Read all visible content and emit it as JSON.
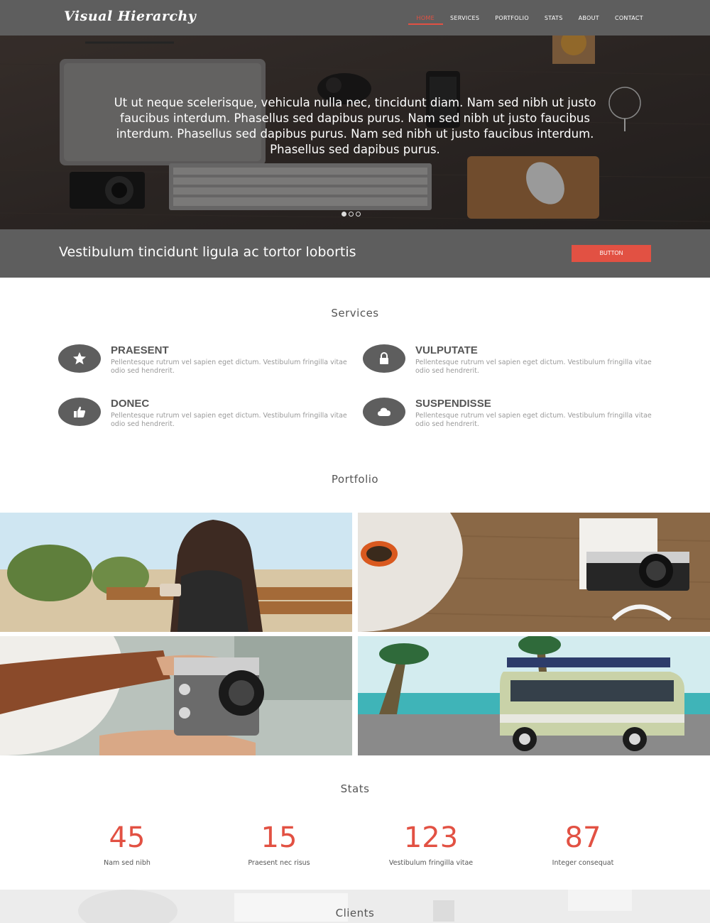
{
  "brand": "Visual Hierarchy",
  "nav": [
    {
      "label": "HOME",
      "active": true
    },
    {
      "label": "SERVICES",
      "active": false
    },
    {
      "label": "PORTFOLIO",
      "active": false
    },
    {
      "label": "STATS",
      "active": false
    },
    {
      "label": "ABOUT",
      "active": false
    },
    {
      "label": "CONTACT",
      "active": false
    }
  ],
  "hero": {
    "text": "Ut ut neque scelerisque, vehicula nulla nec, tincidunt diam. Nam sed nibh ut justo faucibus interdum. Phasellus sed dapibus purus. Nam sed nibh ut justo faucibus interdum. Phasellus sed dapibus purus. Nam sed nibh ut justo faucibus interdum. Phasellus sed dapibus purus.",
    "slides": 3,
    "active_slide": 1
  },
  "cta": {
    "text": "Vestibulum tincidunt ligula ac tortor lobortis",
    "button": "BUTTON"
  },
  "services": {
    "title": "Services",
    "items": [
      {
        "title": "PRAESENT",
        "icon": "star-icon",
        "desc": "Pellentesque rutrum vel sapien eget dictum. Vestibulum fringilla vitae odio sed hendrerit."
      },
      {
        "title": "VULPUTATE",
        "icon": "lock-icon",
        "desc": "Pellentesque rutrum vel sapien eget dictum. Vestibulum fringilla vitae odio sed hendrerit."
      },
      {
        "title": "DONEC",
        "icon": "thumbs-up-icon",
        "desc": "Pellentesque rutrum vel sapien eget dictum. Vestibulum fringilla vitae odio sed hendrerit."
      },
      {
        "title": "SUSPENDISSE",
        "icon": "cloud-icon",
        "desc": "Pellentesque rutrum vel sapien eget dictum. Vestibulum fringilla vitae odio sed hendrerit."
      }
    ]
  },
  "portfolio": {
    "title": "Portfolio",
    "images": [
      "woman-on-bench-photo",
      "camera-and-sunglasses-photo",
      "hands-holding-camera-photo",
      "vintage-van-beach-photo"
    ]
  },
  "stats": {
    "title": "Stats",
    "items": [
      {
        "value": "45",
        "label": "Nam sed nibh"
      },
      {
        "value": "15",
        "label": "Praesent nec risus"
      },
      {
        "value": "123",
        "label": "Vestibulum fringilla vitae"
      },
      {
        "value": "87",
        "label": "Integer consequat"
      }
    ]
  },
  "clients": {
    "title": "Clients"
  },
  "colors": {
    "accent": "#e25143",
    "dark_gray": "#5e5e5e"
  }
}
